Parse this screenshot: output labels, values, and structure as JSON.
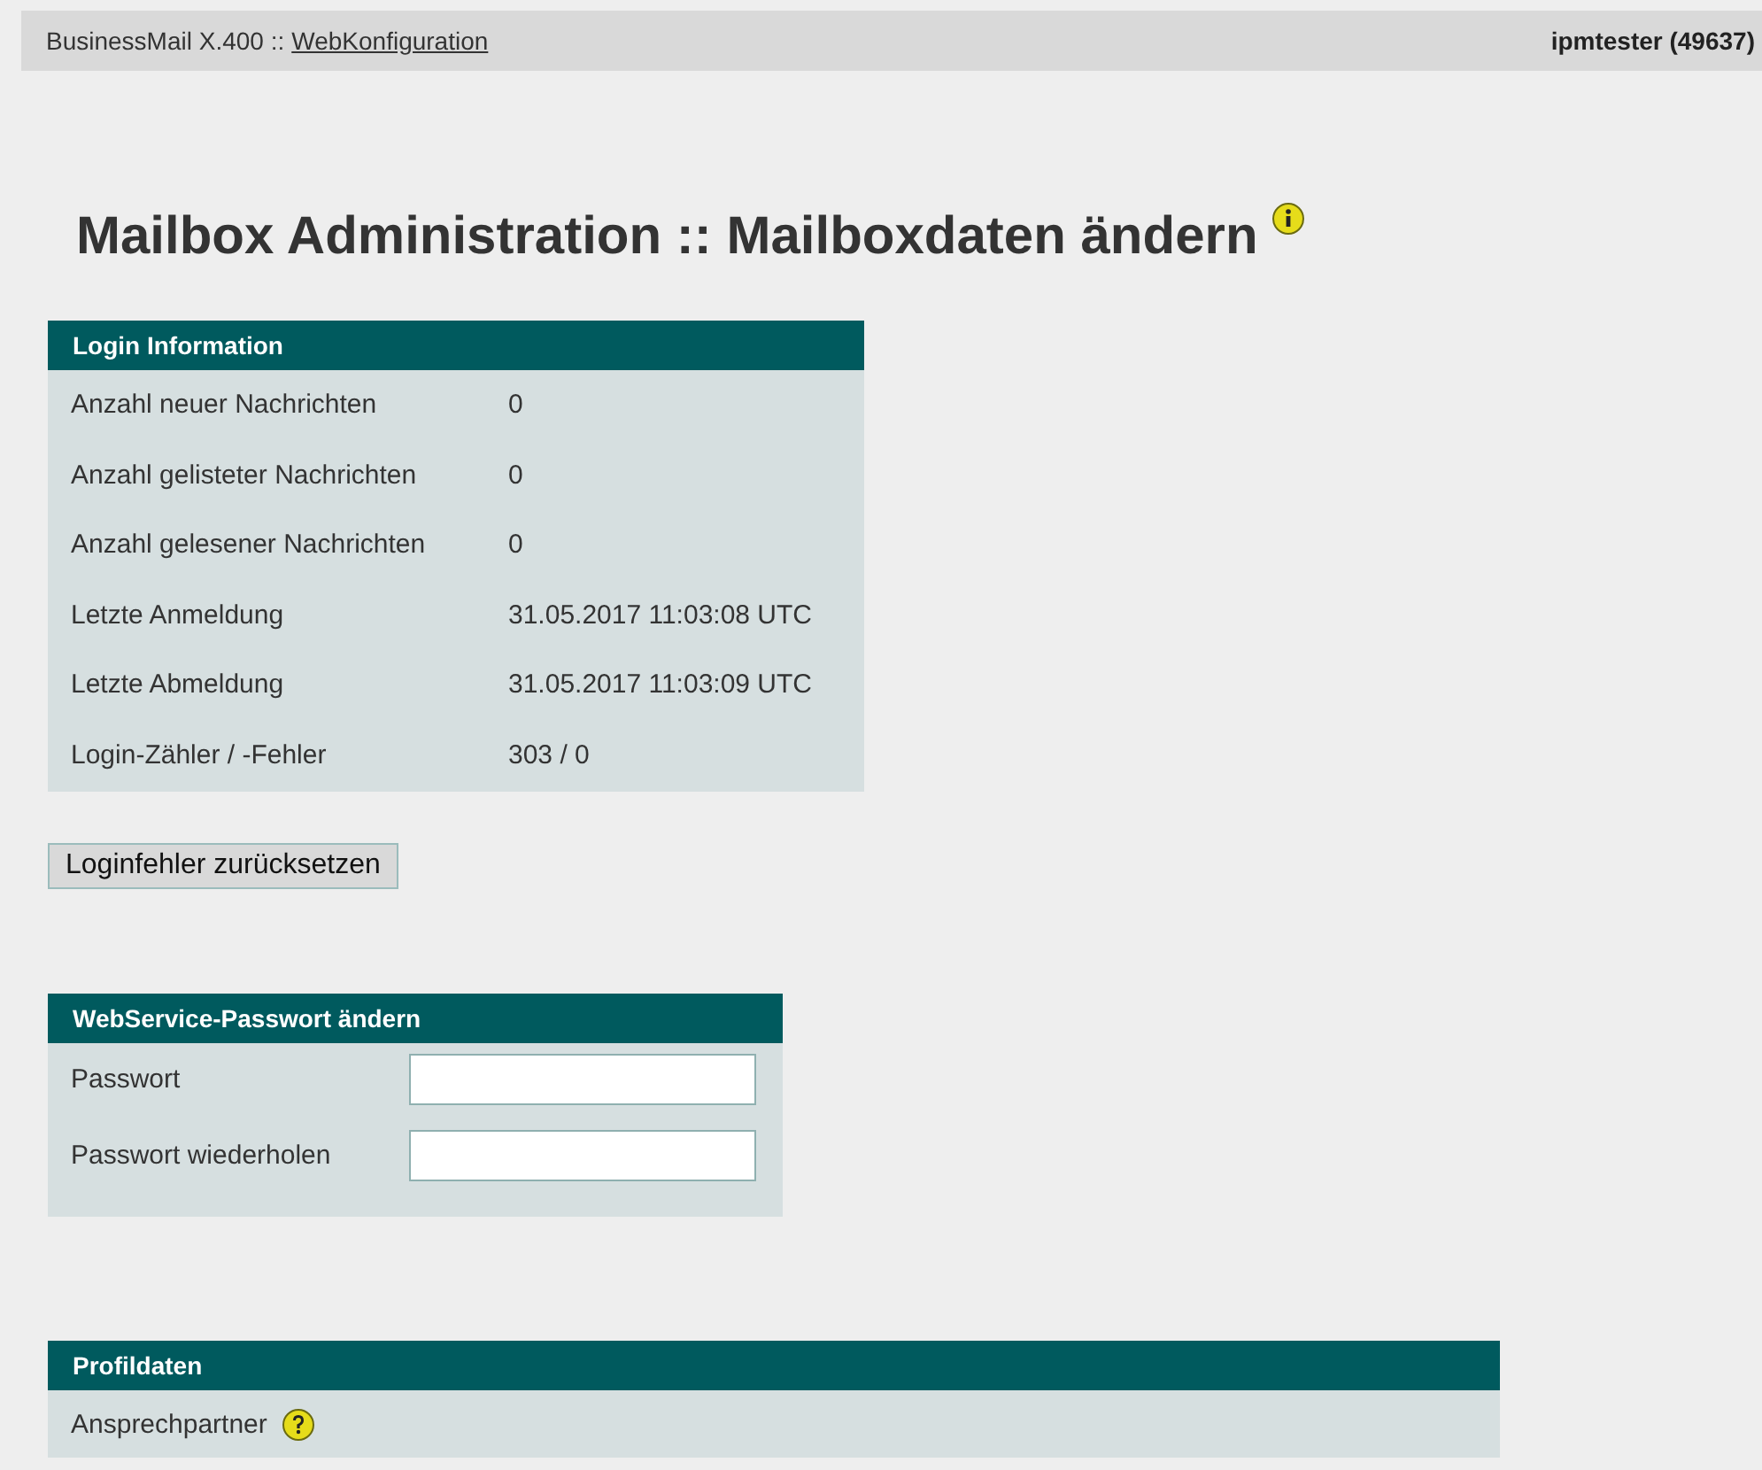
{
  "top_bar": {
    "product": "BusinessMail X.400 ::",
    "link": "WebKonfiguration",
    "user": "ipmtester (49637)"
  },
  "page_title": "Mailbox Administration :: Mailboxdaten ändern",
  "login_information": {
    "title": "Login Information",
    "rows": [
      {
        "label": "Anzahl neuer Nachrichten",
        "value": "0"
      },
      {
        "label": "Anzahl gelisteter Nachrichten",
        "value": "0"
      },
      {
        "label": "Anzahl gelesener Nachrichten",
        "value": "0"
      },
      {
        "label": "Letzte Anmeldung",
        "value": "31.05.2017 11:03:08 UTC"
      },
      {
        "label": "Letzte Abmeldung",
        "value": "31.05.2017 11:03:09 UTC"
      },
      {
        "label": "Login-Zähler / -Fehler",
        "value": "303 / 0"
      }
    ]
  },
  "reset_button": "Loginfehler zurücksetzen",
  "password_panel": {
    "title": "WebService-Passwort ändern",
    "fields": [
      {
        "label": "Passwort"
      },
      {
        "label": "Passwort wiederholen"
      }
    ]
  },
  "profile_panel": {
    "title": "Profildaten",
    "rows": [
      {
        "label": "Ansprechpartner"
      }
    ]
  }
}
